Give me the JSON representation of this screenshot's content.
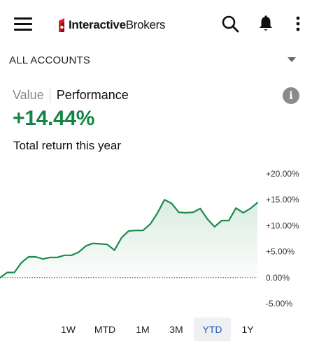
{
  "header": {
    "logo_bold": "Interactive",
    "logo_regular": "Brokers"
  },
  "accounts": {
    "label": "ALL ACCOUNTS"
  },
  "tabs": [
    {
      "label": "Value",
      "active": false
    },
    {
      "label": "Performance",
      "active": true
    }
  ],
  "summary": {
    "return_value": "+14.44%",
    "return_label": "Total return this year"
  },
  "chart_data": {
    "type": "area",
    "title": "",
    "xlabel": "",
    "ylabel": "",
    "ylim": [
      -5,
      20
    ],
    "y_ticks": [
      "+20.00%",
      "+15.00%",
      "+10.00%",
      "+5.00%",
      "0.00%",
      "-5.00%"
    ],
    "y_tick_values": [
      20,
      15,
      10,
      5,
      0,
      -5
    ],
    "baseline": 0,
    "color": "#1a8a4a",
    "series": [
      {
        "values": [
          0.0,
          1.0,
          1.0,
          2.9,
          4.0,
          4.0,
          3.6,
          3.9,
          3.9,
          4.3,
          4.3,
          4.9,
          6.1,
          6.6,
          6.5,
          6.4,
          5.3,
          7.7,
          9.0,
          9.1,
          9.1,
          10.3,
          12.4,
          15.0,
          14.3,
          12.6,
          12.5,
          12.6,
          13.3,
          11.3,
          9.8,
          11.0,
          11.0,
          13.4,
          12.5,
          13.3,
          14.44
        ]
      }
    ]
  },
  "ranges": [
    {
      "label": "1W",
      "active": false
    },
    {
      "label": "MTD",
      "active": false
    },
    {
      "label": "1M",
      "active": false
    },
    {
      "label": "3M",
      "active": false
    },
    {
      "label": "YTD",
      "active": true
    },
    {
      "label": "1Y",
      "active": false
    }
  ]
}
